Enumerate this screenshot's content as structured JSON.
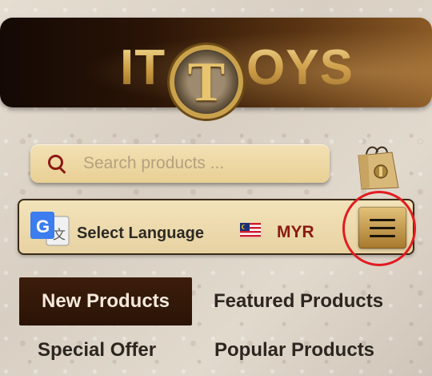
{
  "header": {
    "logo_left": "IT",
    "logo_letter": "T",
    "logo_right": "OYS"
  },
  "search": {
    "placeholder": "Search products ...",
    "icon": "search-icon"
  },
  "cart": {
    "icon": "shopping-bag-icon"
  },
  "toolbar": {
    "translate_icon": "google-translate-icon",
    "language_label": "Select Language",
    "flag_icon": "malaysia-flag-icon",
    "currency": "MYR",
    "menu_icon": "hamburger-menu-icon"
  },
  "tabs": [
    {
      "label": "New Products",
      "active": true
    },
    {
      "label": "Featured Products",
      "active": false
    },
    {
      "label": "Special Offer",
      "active": false
    },
    {
      "label": "Popular Products",
      "active": false
    }
  ],
  "colors": {
    "accent_gold": "#caa24c",
    "currency_red": "#8b1a12",
    "highlight_red": "#e11b22",
    "active_tab": "#3c1d0b"
  }
}
